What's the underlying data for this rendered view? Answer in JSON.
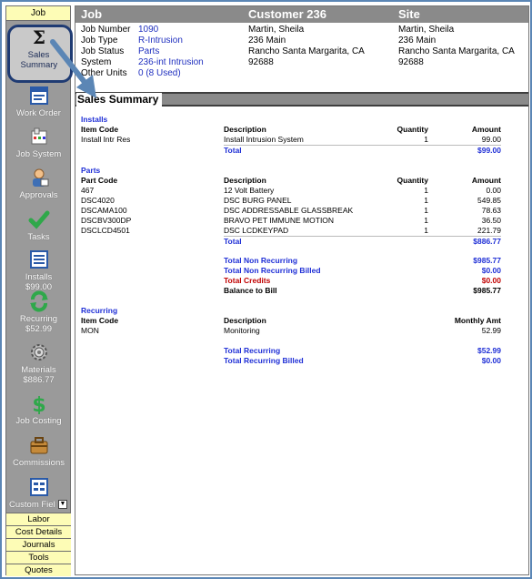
{
  "sidebar": {
    "header": "Job",
    "items": [
      {
        "label": "Sales Summary",
        "icon": "sigma-icon"
      },
      {
        "label": "Work Order",
        "icon": "work-order-icon"
      },
      {
        "label": "Job System",
        "icon": "job-system-icon"
      },
      {
        "label": "Approvals",
        "icon": "approvals-icon"
      },
      {
        "label": "Tasks",
        "icon": "checkmark-icon"
      },
      {
        "label": "Installs",
        "sub": "$99.00",
        "icon": "installs-icon"
      },
      {
        "label": "Recurring",
        "sub": "$52.99",
        "icon": "recurring-icon"
      },
      {
        "label": "Materials",
        "sub": "$886.77",
        "icon": "gear-icon"
      },
      {
        "label": "Job Costing",
        "icon": "dollar-icon"
      },
      {
        "label": "Commissions",
        "icon": "commissions-icon"
      },
      {
        "label": "Custom Fiel",
        "icon": "custom-fields-icon"
      }
    ],
    "bottom_buttons": [
      "Labor",
      "Cost Details",
      "Journals",
      "Tools",
      "Quotes"
    ]
  },
  "header": {
    "job": "Job",
    "customer": "Customer 236",
    "site": "Site"
  },
  "job_info": [
    {
      "key": "Job Number",
      "value": "1090"
    },
    {
      "key": "Job Type",
      "value": "R-Intrusion"
    },
    {
      "key": "Job Status",
      "value": "Parts"
    },
    {
      "key": "System",
      "value": "236-int Intrusion"
    },
    {
      "key": "Other Units",
      "value": "0 (8 Used)"
    }
  ],
  "customer_info": [
    "Martin, Sheila",
    "236 Main",
    "Rancho Santa Margarita, CA",
    "92688"
  ],
  "site_info": [
    "Martin, Sheila",
    "236 Main",
    "Rancho Santa Margarita, CA",
    "92688"
  ],
  "section_title": "Sales Summary",
  "installs": {
    "label": "Installs",
    "headers": {
      "code": "Item Code",
      "desc": "Description",
      "qty": "Quantity",
      "amt": "Amount"
    },
    "rows": [
      {
        "code": "Install Intr Res",
        "desc": "Install Intrusion System",
        "qty": "1",
        "amt": "99.00"
      }
    ],
    "total_label": "Total",
    "total": "$99.00"
  },
  "parts": {
    "label": "Parts",
    "headers": {
      "code": "Part Code",
      "desc": "Description",
      "qty": "Quantity",
      "amt": "Amount"
    },
    "rows": [
      {
        "code": "467",
        "desc": "12 Volt Battery",
        "qty": "1",
        "amt": "0.00"
      },
      {
        "code": "DSC4020",
        "desc": "DSC BURG PANEL",
        "qty": "1",
        "amt": "549.85"
      },
      {
        "code": "DSCAMA100",
        "desc": "DSC ADDRESSABLE GLASSBREAK",
        "qty": "1",
        "amt": "78.63"
      },
      {
        "code": "DSCBV300DP",
        "desc": "BRAVO PET IMMUNE MOTION",
        "qty": "1",
        "amt": "36.50"
      },
      {
        "code": "DSCLCD4501",
        "desc": "DSC LCDKEYPAD",
        "qty": "1",
        "amt": "221.79"
      }
    ],
    "total_label": "Total",
    "total": "$886.77"
  },
  "summary": [
    {
      "label": "Total Non Recurring",
      "value": "$985.77",
      "style": "blue"
    },
    {
      "label": "Total Non Recurring Billed",
      "value": "$0.00",
      "style": "blue"
    },
    {
      "label": "Total Credits",
      "value": "$0.00",
      "style": "red"
    },
    {
      "label": "Balance to Bill",
      "value": "$985.77",
      "style": "black"
    }
  ],
  "recurring": {
    "label": "Recurring",
    "headers": {
      "code": "Item Code",
      "desc": "Description",
      "amt": "Monthly Amt"
    },
    "rows": [
      {
        "code": "MON",
        "desc": "Monitoring",
        "amt": "52.99"
      }
    ],
    "totals": [
      {
        "label": "Total Recurring",
        "value": "$52.99"
      },
      {
        "label": "Total Recurring Billed",
        "value": "$0.00"
      }
    ]
  },
  "colors": {
    "accent_blue": "#1f2fd6",
    "credit_red": "#c00000",
    "sidebar_gray": "#9a9a9a",
    "header_gray": "#8a8a8a",
    "tab_yellow": "#fdfcb6"
  }
}
